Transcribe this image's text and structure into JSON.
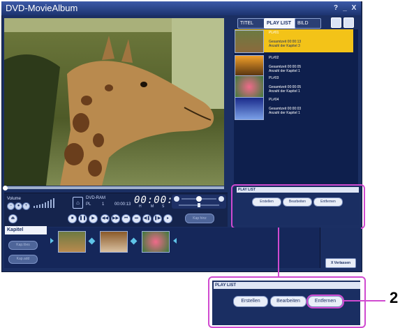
{
  "window": {
    "title": "DVD-MovieAlbum",
    "help": "?",
    "minimize": "_",
    "close": "X"
  },
  "player": {
    "volume_label": "Volume",
    "disc_type": "DVD-RAM",
    "pl_label": "PL",
    "pl_number": "1",
    "total_time": "00:00:13",
    "timecode": "00:00:00",
    "hms": [
      "H",
      "M",
      "S"
    ],
    "kap_hinzu": "Kap hinz"
  },
  "tabs": {
    "titel": "TITEL",
    "playlist": "PLAY LIST",
    "bild": "BILD"
  },
  "playlist_items": [
    {
      "name": "PL#01",
      "line1": "Gesamtzeit 00:00:13",
      "line2": "Anzahl der Kapitel  3",
      "selected": true
    },
    {
      "name": "PL#02",
      "line1": "Gesamtzeit 00:00:05",
      "line2": "Anzahl der Kapitel  1",
      "selected": false
    },
    {
      "name": "PL#03",
      "line1": "Gesamtzeit 00:00:05",
      "line2": "Anzahl der Kapitel  1",
      "selected": false
    },
    {
      "name": "PL#04",
      "line1": "Gesamtzeit 00:00:03",
      "line2": "Anzahl der Kapitel  1",
      "selected": false
    }
  ],
  "playlist_panel": {
    "label": "PLAY LIST",
    "erstellen": "Erstellen",
    "bearbeiten": "Bearbeiten",
    "entfernen": "Entfernen"
  },
  "kapitel": {
    "label": "Kapitel",
    "btn1": "Kap.löes",
    "btn2": "Kap.add"
  },
  "verlassen": "X Verlassen",
  "zoom_panel": {
    "label": "PLAY LIST",
    "erstellen": "Erstellen",
    "bearbeiten": "Bearbeiten",
    "entfernen": "Entfernen"
  },
  "callout": "2",
  "colors": {
    "accent": "#d04ad0",
    "selected": "#f3c318",
    "window": "#1b2f63"
  }
}
